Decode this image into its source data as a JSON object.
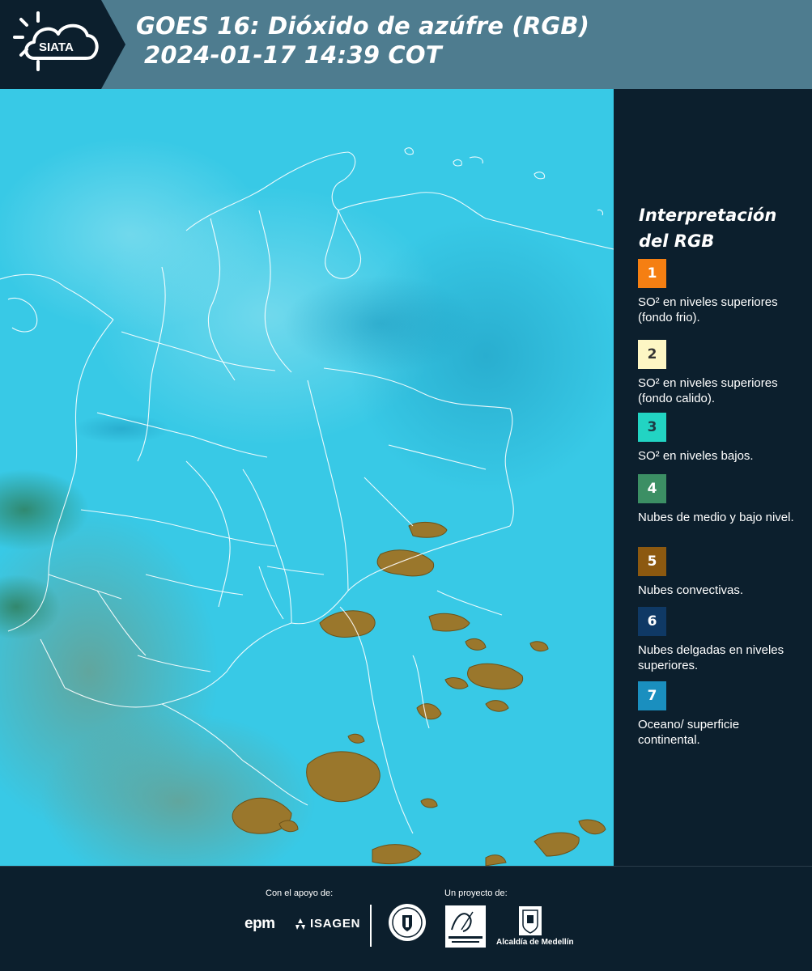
{
  "header": {
    "logo_text": "SIATA",
    "title_line1": "GOES 16: Dióxido de azúfre (RGB)",
    "title_line2": "2024-01-17 14:39 COT"
  },
  "legend": {
    "title": "Interpretación del RGB",
    "items": [
      {
        "number": "1",
        "color": "#f57f12",
        "text_color": "#ffffff",
        "label": "SO² en niveles superiores (fondo frio)."
      },
      {
        "number": "2",
        "color": "#fdf6c4",
        "text_color": "#333333",
        "label": "SO² en niveles superiores (fondo calido)."
      },
      {
        "number": "3",
        "color": "#22d4c3",
        "text_color": "#1d3a44",
        "label": "SO² en niveles bajos."
      },
      {
        "number": "4",
        "color": "#3c8f64",
        "text_color": "#ffffff",
        "label": "Nubes de medio y bajo nivel."
      },
      {
        "number": "5",
        "color": "#8c5910",
        "text_color": "#ffffff",
        "label": "Nubes convectivas."
      },
      {
        "number": "6",
        "color": "#0f3965",
        "text_color": "#ffffff",
        "label": "Nubes delgadas en niveles superiores."
      },
      {
        "number": "7",
        "color": "#1a8fbf",
        "text_color": "#ffffff",
        "label": "Oceano/ superficie continental."
      }
    ]
  },
  "colors": {
    "background": "#0c1f2d",
    "header_band": "#4e7c8f",
    "ocean": "#35c8e6",
    "land": "#4cc6e0",
    "convective": "#9c7a2c",
    "border_lines": "#ffffff"
  },
  "footer": {
    "support_label": "Con el apoyo de:",
    "project_label": "Un proyecto de:",
    "sponsor_1": "epm",
    "sponsor_2": "ISAGEN",
    "partner_3": "Alcaldía de Medellín"
  }
}
